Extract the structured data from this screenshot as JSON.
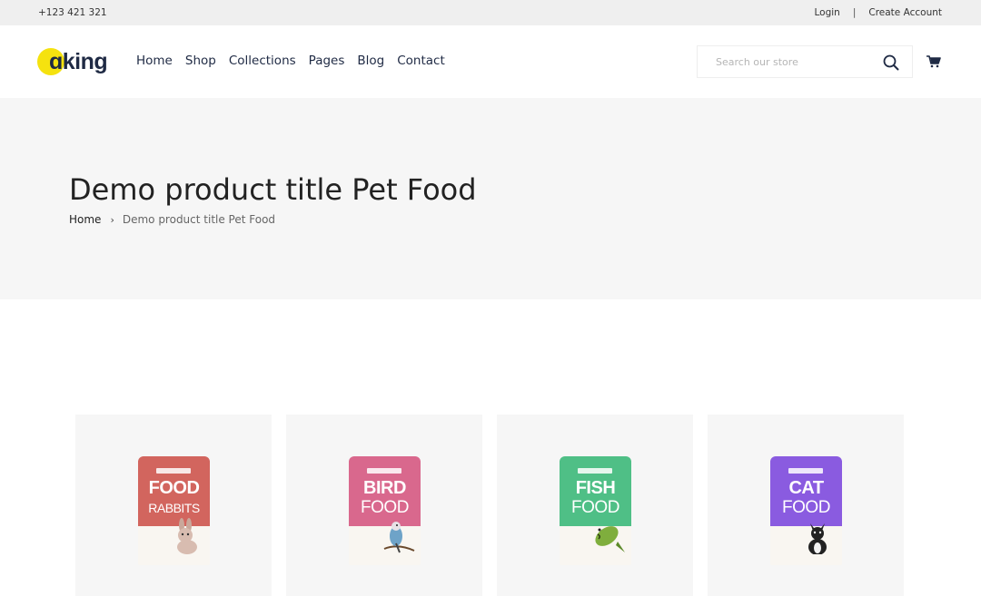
{
  "topbar": {
    "phone": "+123 421 321",
    "login": "Login",
    "separator": "|",
    "create_account": "Create Account"
  },
  "logo": {
    "text": "ɑking"
  },
  "nav": {
    "items": [
      "Home",
      "Shop",
      "Collections",
      "Pages",
      "Blog",
      "Contact"
    ]
  },
  "search": {
    "placeholder": "Search our store",
    "icon": "search-icon"
  },
  "cart": {
    "icon": "cart-icon"
  },
  "banner": {
    "title": "Demo product title Pet Food"
  },
  "breadcrumb": {
    "home": "Home",
    "separator": "›",
    "current": "Demo product title Pet Food"
  },
  "products": [
    {
      "line1": "FOOD",
      "line2": "RABBITS",
      "color": "#d2655e",
      "pet": "rabbit"
    },
    {
      "line1": "BIRD",
      "line2": "FOOD",
      "color": "#d9688d",
      "pet": "bird"
    },
    {
      "line1": "FISH",
      "line2": "FOOD",
      "color": "#4fbf86",
      "pet": "fish"
    },
    {
      "line1": "CAT",
      "line2": "FOOD",
      "color": "#8a5be0",
      "pet": "cat"
    }
  ],
  "colors": {
    "logo_dot": "#f5e20f",
    "text_dark": "#1f2a44",
    "banner_bg": "#f6f6f6"
  }
}
